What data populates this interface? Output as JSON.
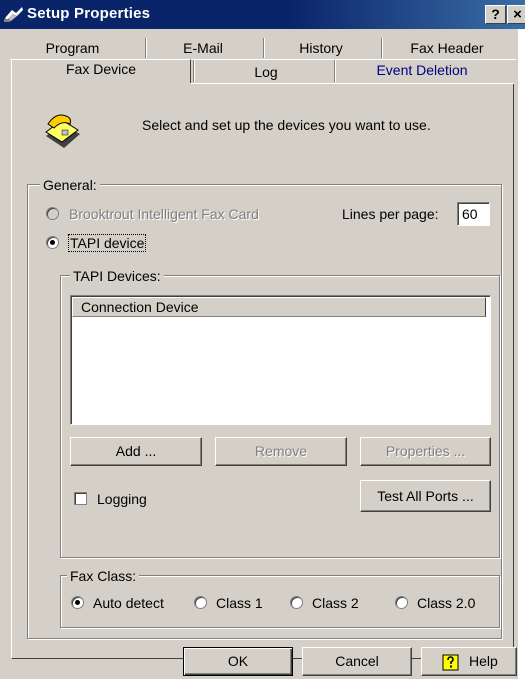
{
  "window": {
    "title": "Setup Properties",
    "help_glyph": "?",
    "close_glyph": "×"
  },
  "tabs": {
    "row_back": [
      "Program",
      "E-Mail",
      "History",
      "Fax Header"
    ],
    "row_front": [
      "Fax Device",
      "Log",
      "Event Deletion"
    ],
    "active": "Fax Device"
  },
  "header": {
    "icon": "fax-machine-icon",
    "text": "Select and set up the devices you want to use."
  },
  "general": {
    "legend": "General:",
    "brooktrout_label": "Brooktrout Intelligent Fax Card",
    "tapi_label": "TAPI device",
    "selected": "TAPI device",
    "lines_label": "Lines per page:",
    "lines_value": "60"
  },
  "tapi_devices": {
    "legend": "TAPI Devices:",
    "column_header": "Connection Device",
    "rows": [],
    "add_label": "Add ...",
    "remove_label": "Remove",
    "properties_label": "Properties ...",
    "logging_label": "Logging",
    "logging_checked": false,
    "test_ports_label": "Test All Ports ..."
  },
  "fax_class": {
    "legend": "Fax Class:",
    "options": [
      "Auto detect",
      "Class 1",
      "Class 2",
      "Class 2.0"
    ],
    "selected": "Auto detect"
  },
  "footer": {
    "ok_label": "OK",
    "cancel_label": "Cancel",
    "help_label": "Help",
    "help_icon": "help-book-icon"
  },
  "colors": {
    "titlebar": "#0a246a",
    "face": "#d4d0c8",
    "link_tab": "#000080"
  }
}
